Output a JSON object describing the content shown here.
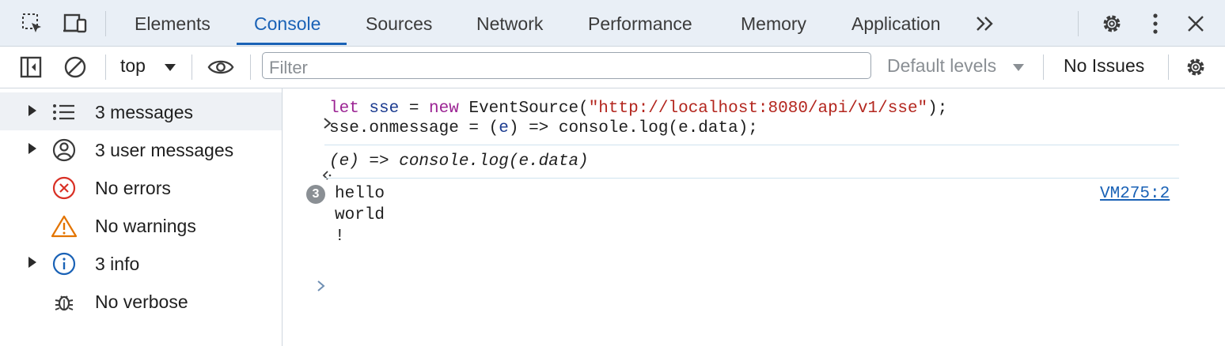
{
  "tabs": [
    {
      "label": "Elements",
      "active": false
    },
    {
      "label": "Console",
      "active": true
    },
    {
      "label": "Sources",
      "active": false
    },
    {
      "label": "Network",
      "active": false
    },
    {
      "label": "Performance",
      "active": false
    },
    {
      "label": "Memory",
      "active": false
    },
    {
      "label": "Application",
      "active": false
    }
  ],
  "toolbar": {
    "context": "top",
    "filter_placeholder": "Filter",
    "levels": "Default levels",
    "issues": "No Issues"
  },
  "sidebar": {
    "items": [
      {
        "label": "3 messages",
        "icon": "list-icon",
        "expandable": true,
        "selected": true
      },
      {
        "label": "3 user messages",
        "icon": "user-icon",
        "expandable": true,
        "selected": false
      },
      {
        "label": "No errors",
        "icon": "error-icon",
        "expandable": false,
        "selected": false
      },
      {
        "label": "No warnings",
        "icon": "warning-icon",
        "expandable": false,
        "selected": false
      },
      {
        "label": "3 info",
        "icon": "info-icon",
        "expandable": true,
        "selected": false
      },
      {
        "label": "No verbose",
        "icon": "bug-icon",
        "expandable": false,
        "selected": false
      }
    ]
  },
  "console": {
    "input_line1": {
      "kw1": "let",
      "var1": "sse",
      "op1": " = ",
      "kw2": "new",
      "rest1": " EventSource(",
      "url": "\"http://localhost:8080/api/v1/sse\"",
      "rest2": ");"
    },
    "input_line2": {
      "pre": "sse.onmessage = (",
      "var": "e",
      "post": ") => console.log(e.data);"
    },
    "result": "(e) => console.log(e.data)",
    "log_count": "3",
    "log_lines": [
      "hello",
      "world",
      "!"
    ],
    "source_link": "VM275:2"
  },
  "colors": {
    "accent": "#1a62b6",
    "keyword": "#9b2393",
    "string": "#b3261e",
    "error": "#d93025",
    "warning": "#e37400"
  }
}
